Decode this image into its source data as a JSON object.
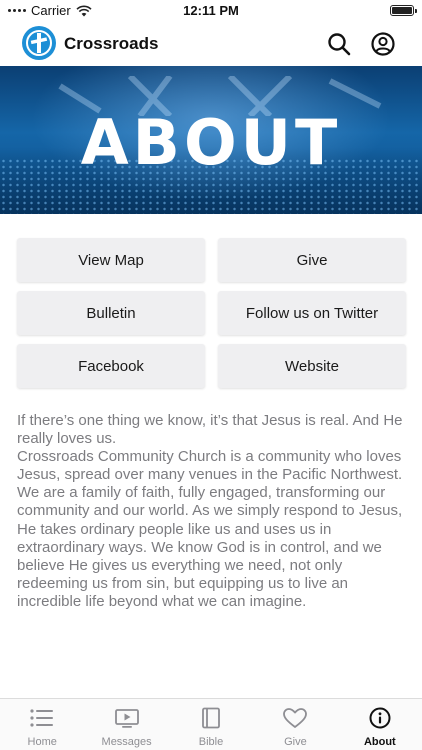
{
  "status_bar": {
    "carrier": "Carrier",
    "time": "12:11 PM"
  },
  "header": {
    "app_title": "Crossroads",
    "icons": [
      "crossroads-logo",
      "search-icon",
      "profile-icon"
    ]
  },
  "banner": {
    "title": "ABOUT"
  },
  "links": [
    {
      "label": "View Map"
    },
    {
      "label": "Give"
    },
    {
      "label": "Bulletin"
    },
    {
      "label": "Follow us on Twitter"
    },
    {
      "label": "Facebook"
    },
    {
      "label": "Website"
    }
  ],
  "description": {
    "line1": "If there’s one thing we know, it’s that Jesus is real. And He really loves us.",
    "line2": "Crossroads Community Church is a community who loves Jesus, spread over many venues in the Pacific Northwest. We are a family of faith, fully engaged, transforming our community and our world. As we simply respond to Jesus, He takes ordinary people like us and uses us in extraordinary ways. We know God is in control, and we believe He gives us everything we need, not only redeeming us from sin, but equipping us to live an incredible life beyond what we can imagine."
  },
  "tabbar": {
    "active": "About",
    "tabs": [
      {
        "label": "Home",
        "icon": "list-icon"
      },
      {
        "label": "Messages",
        "icon": "video-icon"
      },
      {
        "label": "Bible",
        "icon": "book-icon"
      },
      {
        "label": "Give",
        "icon": "heart-icon"
      },
      {
        "label": "About",
        "icon": "info-icon"
      }
    ]
  },
  "colors": {
    "brand_blue": "#1d8fd6",
    "button_bg": "#efeff1",
    "body_text": "#7c7c80",
    "tab_inactive": "#8e8e93"
  }
}
